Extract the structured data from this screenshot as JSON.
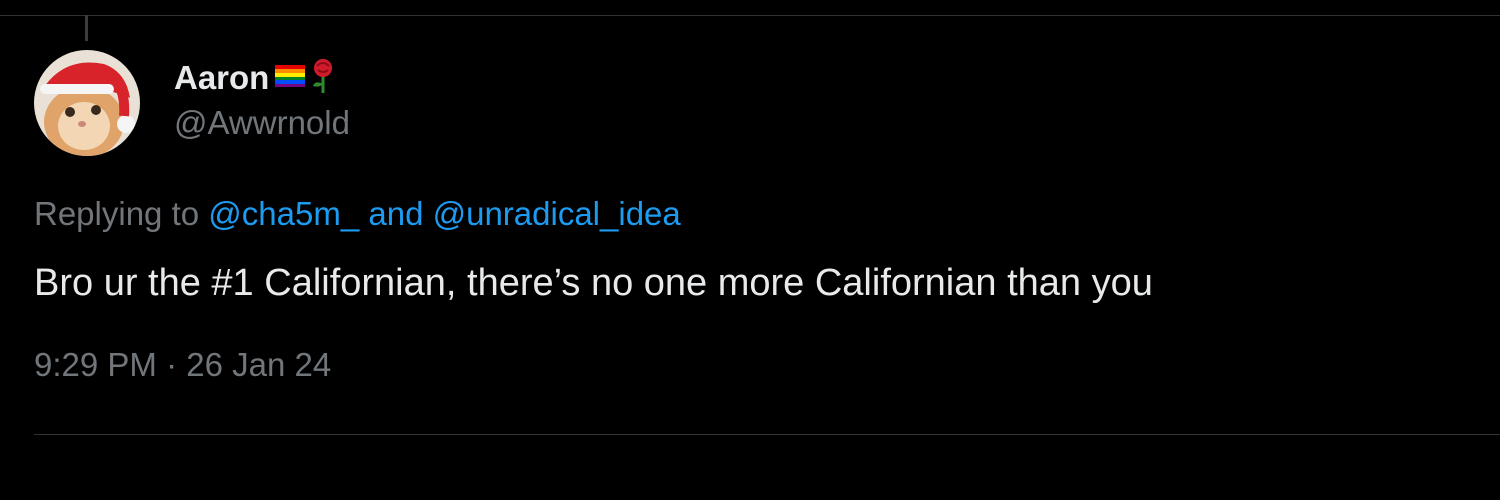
{
  "tweet": {
    "author": {
      "display_name": "Aaron",
      "handle": "@Awwrnold",
      "name_emojis": [
        "rainbow-flag-icon",
        "rose-icon"
      ]
    },
    "reply_prefix": "Replying to",
    "reply_to": [
      "@cha5m_",
      "@unradical_idea"
    ],
    "reply_joiner": "and",
    "text": "Bro ur the #1 Californian, there’s no one more Californian than you",
    "time": "9:29 PM",
    "separator": "·",
    "date": "26 Jan 24"
  },
  "colors": {
    "background": "#000000",
    "text_primary": "#e7e9ea",
    "text_secondary": "#71767b",
    "link": "#1d9bf0",
    "divider": "#2f3336"
  }
}
